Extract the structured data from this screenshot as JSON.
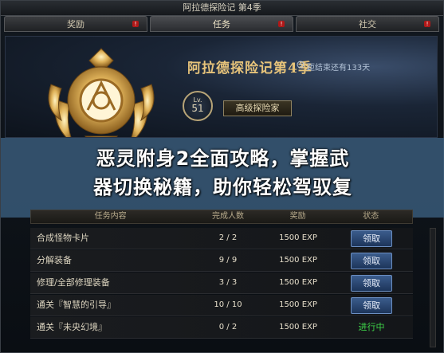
{
  "window": {
    "title": "阿拉德探险记 第4季"
  },
  "tabs": [
    {
      "label": "奖励",
      "badge": "!"
    },
    {
      "label": "任务",
      "badge": "!"
    },
    {
      "label": "社交",
      "badge": "!"
    }
  ],
  "banner": {
    "title": "阿拉德探险记第4季",
    "countdown": "距结束还有133天",
    "level_prefix": "Lv.",
    "level": "51",
    "rank": "高级探险家"
  },
  "overlay": {
    "line1": "恶灵附身2全面攻略，掌握武",
    "line2": "器切换秘籍，助你轻松驾驭复"
  },
  "table": {
    "headers": [
      "任务内容",
      "完成人数",
      "奖励",
      "状态"
    ],
    "rows": [
      {
        "task": "合成怪物卡片",
        "progress": "2 / 2",
        "reward": "1500 EXP",
        "status": "领取",
        "status_type": "button"
      },
      {
        "task": "分解装备",
        "progress": "9 / 9",
        "reward": "1500 EXP",
        "status": "领取",
        "status_type": "button"
      },
      {
        "task": "修理/全部修理装备",
        "progress": "3 / 3",
        "reward": "1500 EXP",
        "status": "领取",
        "status_type": "button"
      },
      {
        "task": "通关『智慧的引导』",
        "progress": "10 / 10",
        "reward": "1500 EXP",
        "status": "领取",
        "status_type": "button"
      },
      {
        "task": "通关『未央幻境』",
        "progress": "0 / 2",
        "reward": "1500 EXP",
        "status": "进行中",
        "status_type": "text"
      }
    ]
  },
  "colors": {
    "accent_gold": "#e6c37a",
    "button_blue": "#3b5c8c",
    "in_progress_green": "#3fd64a",
    "overlay": "#3c6082"
  },
  "icons": {
    "emblem": "golden-wreath-emblem-icon",
    "clock": "clock-icon",
    "badge": "exclamation-badge-icon"
  }
}
